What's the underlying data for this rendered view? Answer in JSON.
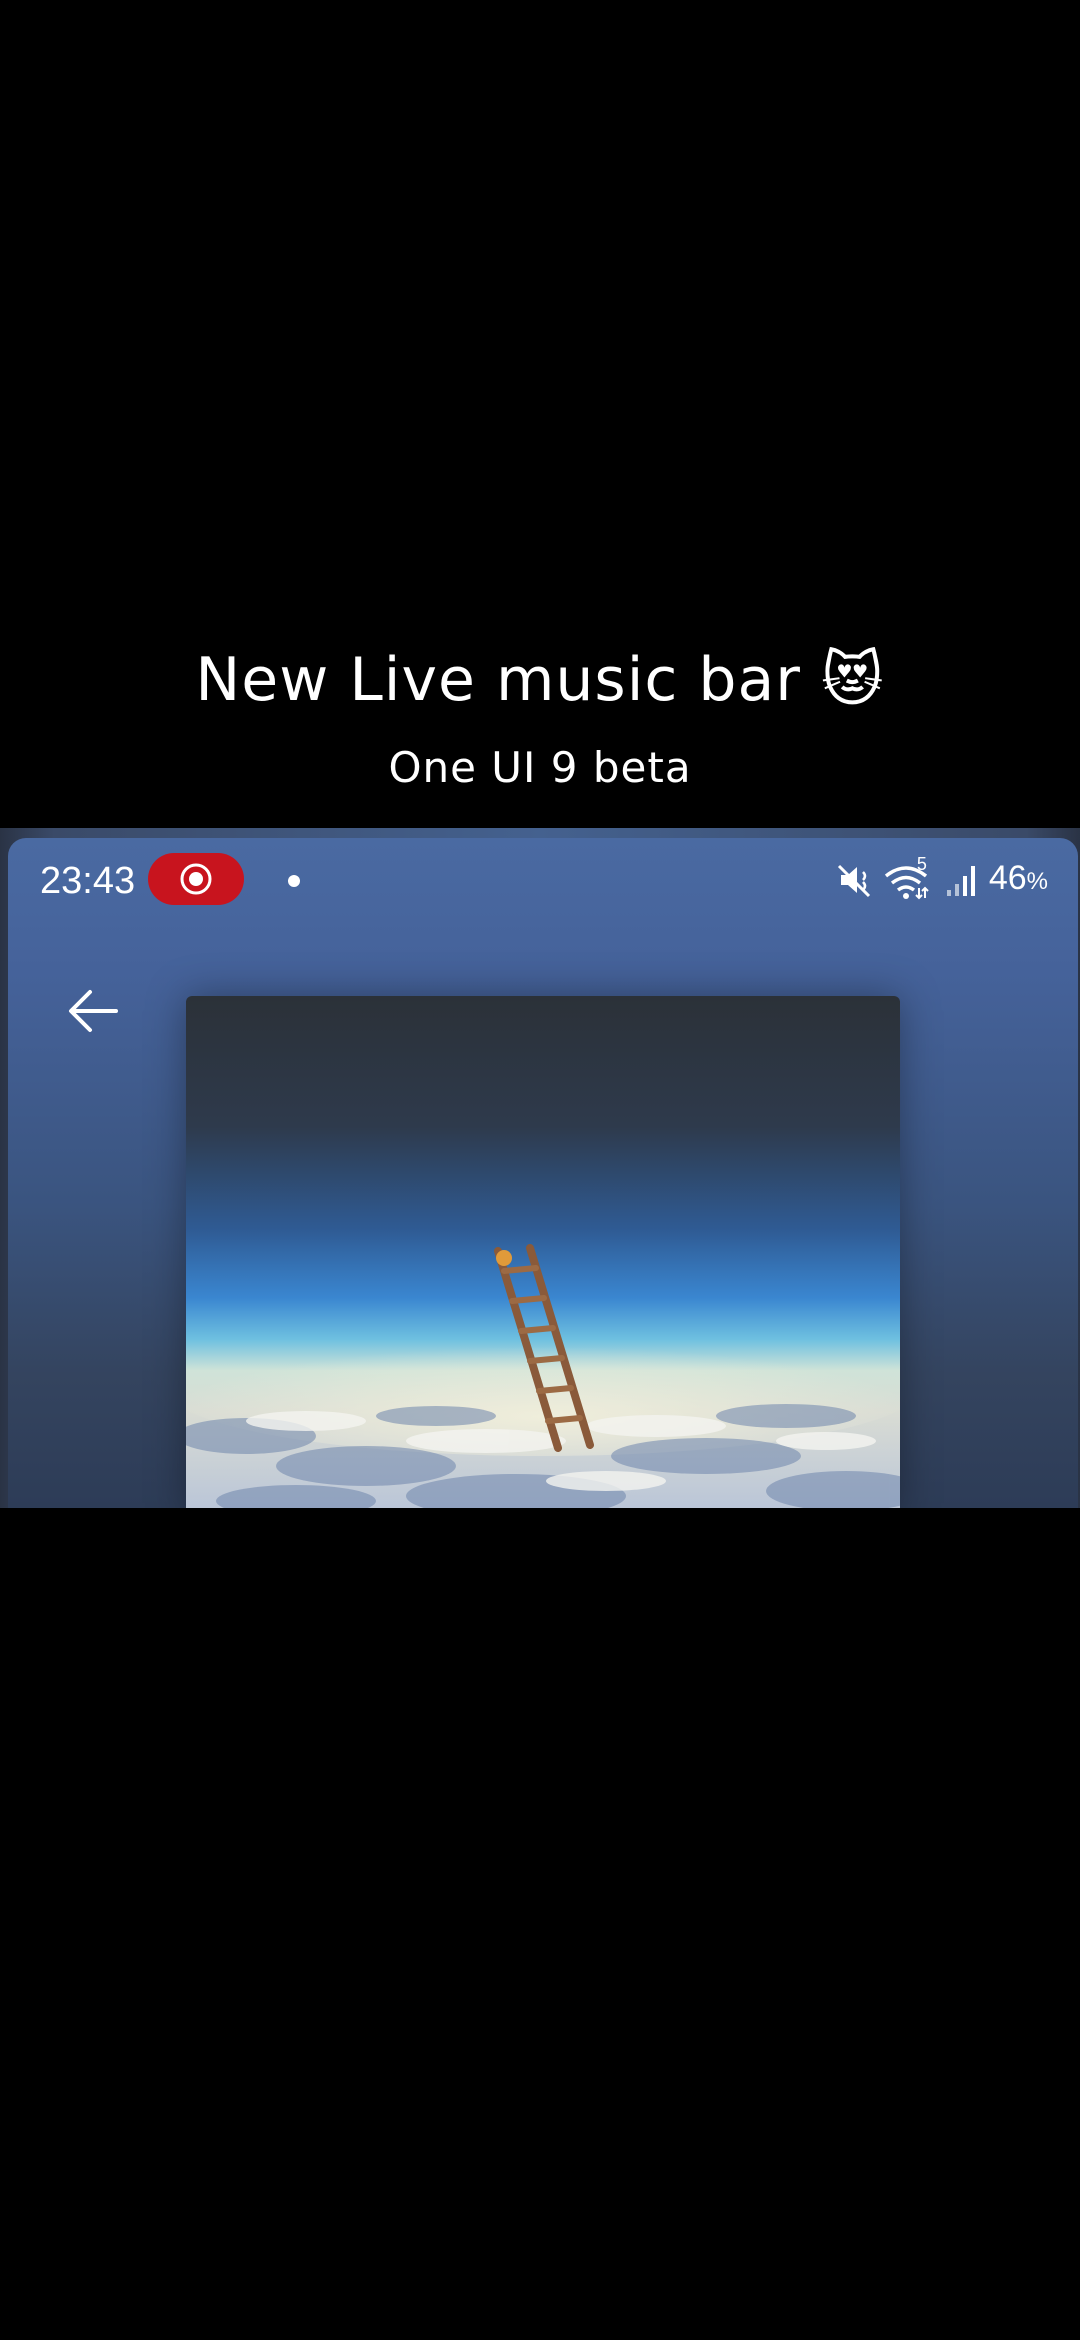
{
  "caption": {
    "title": "New Live music bar 😻",
    "subtitle": "One UI 9 beta"
  },
  "status_bar": {
    "time": "23:43",
    "battery_value": "46",
    "battery_unit": "%",
    "wifi_badge": "5",
    "icons": [
      "screen-record-icon",
      "notification-dot",
      "mute-icon",
      "wifi-icon",
      "signal-icon"
    ]
  },
  "colors": {
    "record_pill": "#c8141e",
    "screen_top": "#4a6aa2",
    "screen_bottom": "#2d3c57"
  },
  "player": {
    "back_icon": "arrow-left-icon",
    "album_art": "album-cover-ladder-in-clouds"
  }
}
